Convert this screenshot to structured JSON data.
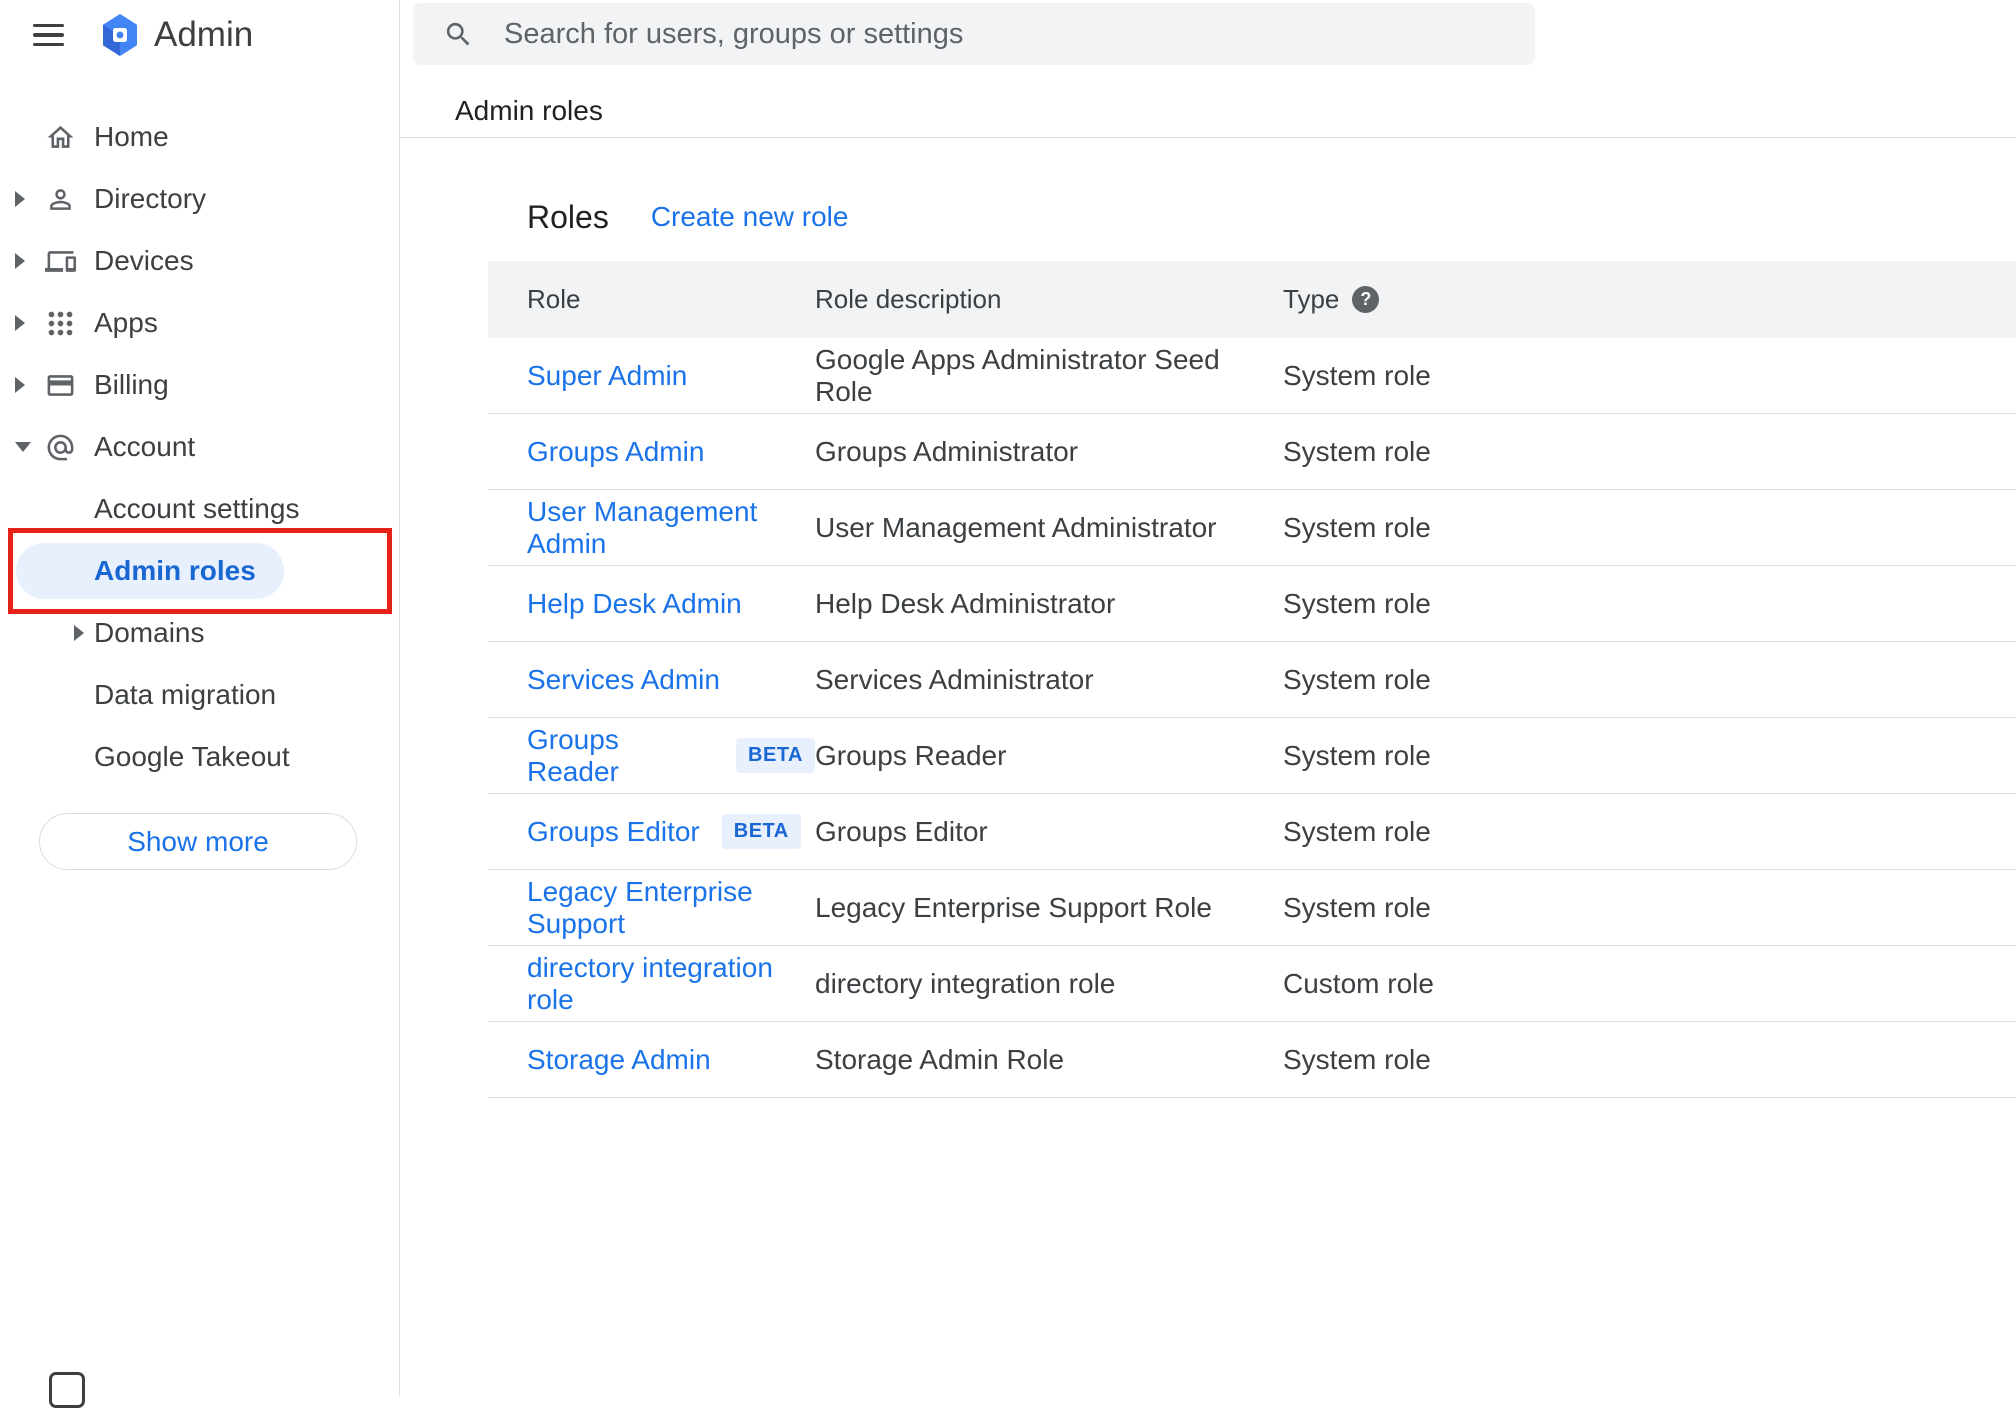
{
  "app": {
    "title": "Admin"
  },
  "search": {
    "placeholder": "Search for users, groups or settings"
  },
  "page": {
    "title": "Admin roles"
  },
  "sidebar": {
    "items": [
      {
        "label": "Home",
        "icon": "home-icon",
        "expand": null
      },
      {
        "label": "Directory",
        "icon": "person-icon",
        "expand": "collapsed"
      },
      {
        "label": "Devices",
        "icon": "devices-icon",
        "expand": "collapsed"
      },
      {
        "label": "Apps",
        "icon": "apps-grid-icon",
        "expand": "collapsed"
      },
      {
        "label": "Billing",
        "icon": "billing-icon",
        "expand": "collapsed"
      },
      {
        "label": "Account",
        "icon": "at-icon",
        "expand": "expanded",
        "children": [
          {
            "label": "Account settings"
          },
          {
            "label": "Admin roles",
            "selected": true,
            "annotated": true
          },
          {
            "label": "Domains",
            "expand": "collapsed"
          },
          {
            "label": "Data migration"
          },
          {
            "label": "Google Takeout"
          }
        ]
      }
    ],
    "show_more_label": "Show more"
  },
  "roles_panel": {
    "title": "Roles",
    "create_link": "Create new role",
    "columns": {
      "role": "Role",
      "description": "Role description",
      "type": "Type"
    },
    "beta_label": "BETA",
    "help_glyph": "?",
    "rows": [
      {
        "role": "Super Admin",
        "beta": false,
        "description": "Google Apps Administrator Seed Role",
        "type": "System role"
      },
      {
        "role": "Groups Admin",
        "beta": false,
        "description": "Groups Administrator",
        "type": "System role"
      },
      {
        "role": "User Management Admin",
        "beta": false,
        "description": "User Management Administrator",
        "type": "System role"
      },
      {
        "role": "Help Desk Admin",
        "beta": false,
        "description": "Help Desk Administrator",
        "type": "System role"
      },
      {
        "role": "Services Admin",
        "beta": false,
        "description": "Services Administrator",
        "type": "System role"
      },
      {
        "role": "Groups Reader",
        "beta": true,
        "description": "Groups Reader",
        "type": "System role"
      },
      {
        "role": "Groups Editor",
        "beta": true,
        "description": "Groups Editor",
        "type": "System role"
      },
      {
        "role": "Legacy Enterprise Support",
        "beta": false,
        "description": "Legacy Enterprise Support Role",
        "type": "System role"
      },
      {
        "role": "directory integration role",
        "beta": false,
        "description": "directory integration role",
        "type": "Custom role"
      },
      {
        "role": "Storage Admin",
        "beta": false,
        "description": "Storage Admin Role",
        "type": "System role"
      }
    ]
  },
  "colors": {
    "link_blue": "#1a73e8",
    "selected_blue": "#1967d2",
    "selected_bg": "#e8f0fe",
    "header_band_gray": "#f1f3f4",
    "annotation_red": "#e42218",
    "logo_blue": "#4285f4"
  }
}
